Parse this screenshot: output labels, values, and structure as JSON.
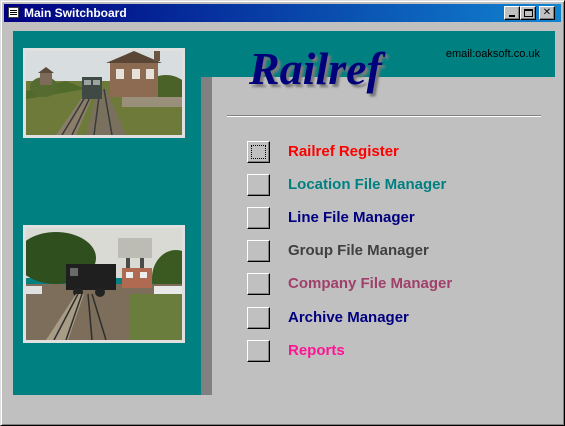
{
  "window": {
    "title": "Main Switchboard"
  },
  "header": {
    "logo_text": "Railref",
    "email": "email:oaksoft.co.uk"
  },
  "menu": {
    "items": [
      {
        "label": "Railref Register",
        "color": "#ff0000"
      },
      {
        "label": "Location File Manager",
        "color": "#008080"
      },
      {
        "label": "Line File Manager",
        "color": "#000080"
      },
      {
        "label": "Group File Manager",
        "color": "#404040"
      },
      {
        "label": "Company File Manager",
        "color": "#a0406a"
      },
      {
        "label": "Archive Manager",
        "color": "#000080"
      },
      {
        "label": "Reports",
        "color": "#ff1493"
      }
    ]
  },
  "colors": {
    "teal_panel": "#008080",
    "titlebar": "#000080",
    "face": "#c0c0c0"
  }
}
